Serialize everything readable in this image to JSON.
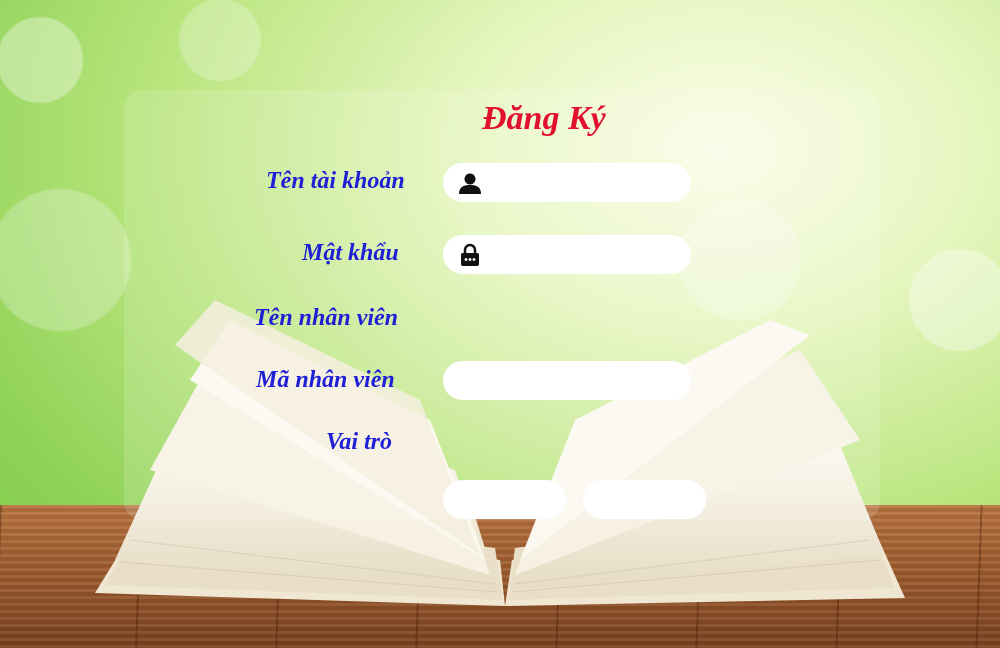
{
  "form": {
    "title": "Đăng Ký",
    "username_label": "Tên tài khoản",
    "password_label": "Mật khẩu",
    "employee_name_label": "Tên nhân viên",
    "employee_id_label": "Mã nhân viên",
    "role_label": "Vai trò",
    "username_value": "",
    "password_value": "",
    "employee_id_value": "",
    "submit_label": "",
    "cancel_label": ""
  },
  "icons": {
    "username": "user-icon",
    "password": "lock-icon"
  },
  "colors": {
    "title": "#e0102e",
    "labels": "#1f1fd6",
    "fields": "#ffffff"
  }
}
